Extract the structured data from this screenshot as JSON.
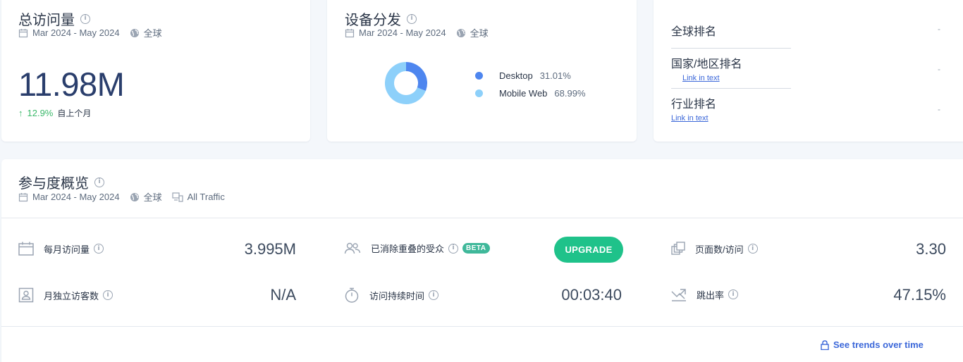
{
  "date_range": "Mar 2024 - May 2024",
  "region": "全球",
  "visits_card": {
    "title": "总访问量",
    "value": "11.98M",
    "change": "12.9%",
    "change_label": "自上个月"
  },
  "devices_card": {
    "title": "设备分发",
    "segments": [
      {
        "name": "Desktop",
        "value_label": "31.01%",
        "fraction": 0.3101,
        "color": "#4e86ef"
      },
      {
        "name": "Mobile Web",
        "value_label": "68.99%",
        "fraction": 0.6899,
        "color": "#8dd0fa"
      }
    ]
  },
  "rank_card": {
    "global_rank": {
      "label": "全球排名",
      "value": "-"
    },
    "country_rank": {
      "label": "国家/地区排名",
      "link": "Link in text",
      "value": "-"
    },
    "industry_rank": {
      "label": "行业排名",
      "link": "Link in text",
      "value": "-"
    }
  },
  "engagement": {
    "title": "参与度概览",
    "traffic": "All Traffic",
    "metrics": {
      "monthly_visits": {
        "label": "每月访问量",
        "value": "3.995M"
      },
      "unique_visitors": {
        "label": "月独立访客数",
        "value": "N/A"
      },
      "dedup_audience": {
        "label": "已消除重叠的受众",
        "badge": "BETA",
        "button": "UPGRADE"
      },
      "visit_duration": {
        "label": "访问持续时间",
        "value": "00:03:40"
      },
      "pages_per_visit": {
        "label": "页面数/访问",
        "value": "3.30"
      },
      "bounce_rate": {
        "label": "跳出率",
        "value": "47.15%"
      }
    },
    "trends_link": "See trends over time"
  },
  "colors": {
    "accent_green": "#1fc28a",
    "up_green": "#3cb96b",
    "link_blue": "#3b67d9",
    "beta_green": "#3fb89a"
  }
}
